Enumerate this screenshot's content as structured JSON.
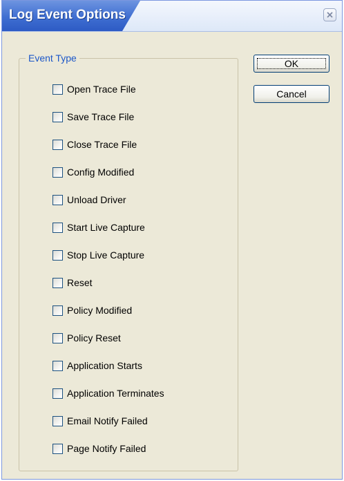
{
  "window": {
    "title": "Log Event Options"
  },
  "group": {
    "legend": "Event Type"
  },
  "buttons": {
    "ok_label": "OK",
    "cancel_label": "Cancel"
  },
  "event_types": [
    {
      "label": "Open Trace File",
      "checked": false
    },
    {
      "label": "Save Trace File",
      "checked": false
    },
    {
      "label": "Close Trace File",
      "checked": false
    },
    {
      "label": "Config Modified",
      "checked": false
    },
    {
      "label": "Unload Driver",
      "checked": false
    },
    {
      "label": "Start Live Capture",
      "checked": false
    },
    {
      "label": "Stop Live Capture",
      "checked": false
    },
    {
      "label": "Reset",
      "checked": false
    },
    {
      "label": "Policy Modified",
      "checked": false
    },
    {
      "label": "Policy Reset",
      "checked": false
    },
    {
      "label": "Application Starts",
      "checked": false
    },
    {
      "label": "Application Terminates",
      "checked": false
    },
    {
      "label": "Email Notify Failed",
      "checked": false
    },
    {
      "label": "Page Notify Failed",
      "checked": false
    }
  ],
  "icons": {
    "close": "close-icon"
  },
  "colors": {
    "title_gradient_dark": "#2d5bc4",
    "group_legend": "#1c57c8",
    "dialog_bg": "#ece9d8"
  }
}
